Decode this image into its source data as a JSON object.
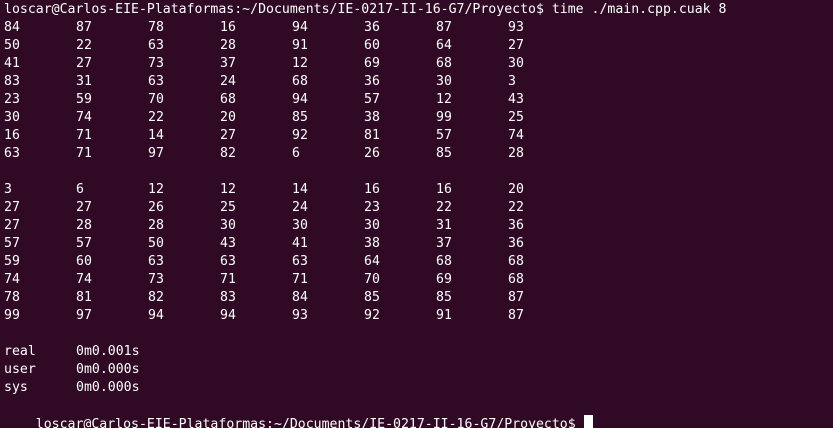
{
  "terminal": {
    "command_line": "loscar@Carlos-EIE-Plataformas:~/Documents/IE-0217-II-16-G7/Proyecto$ time ./main.cpp.cuak 8",
    "matrix_before": [
      [
        "84",
        "87",
        "78",
        "16",
        "94",
        "36",
        "87",
        "93"
      ],
      [
        "50",
        "22",
        "63",
        "28",
        "91",
        "60",
        "64",
        "27"
      ],
      [
        "41",
        "27",
        "73",
        "37",
        "12",
        "69",
        "68",
        "30"
      ],
      [
        "83",
        "31",
        "63",
        "24",
        "68",
        "36",
        "30",
        "3"
      ],
      [
        "23",
        "59",
        "70",
        "68",
        "94",
        "57",
        "12",
        "43"
      ],
      [
        "30",
        "74",
        "22",
        "20",
        "85",
        "38",
        "99",
        "25"
      ],
      [
        "16",
        "71",
        "14",
        "27",
        "92",
        "81",
        "57",
        "74"
      ],
      [
        "63",
        "71",
        "97",
        "82",
        "6",
        "26",
        "85",
        "28"
      ]
    ],
    "matrix_after": [
      [
        "3",
        "6",
        "12",
        "12",
        "14",
        "16",
        "16",
        "20"
      ],
      [
        "27",
        "27",
        "26",
        "25",
        "24",
        "23",
        "22",
        "22"
      ],
      [
        "27",
        "28",
        "28",
        "30",
        "30",
        "30",
        "31",
        "36"
      ],
      [
        "57",
        "57",
        "50",
        "43",
        "41",
        "38",
        "37",
        "36"
      ],
      [
        "59",
        "60",
        "63",
        "63",
        "63",
        "64",
        "68",
        "68"
      ],
      [
        "74",
        "74",
        "73",
        "71",
        "71",
        "70",
        "69",
        "68"
      ],
      [
        "78",
        "81",
        "82",
        "83",
        "84",
        "85",
        "85",
        "87"
      ],
      [
        "99",
        "97",
        "94",
        "94",
        "93",
        "92",
        "91",
        "87"
      ]
    ],
    "timing": {
      "real_label": "real",
      "real_value": "0m0.001s",
      "user_label": "user",
      "user_value": "0m0.000s",
      "sys_label": "sys",
      "sys_value": "0m0.000s"
    },
    "prompt": "loscar@Carlos-EIE-Plataformas:~/Documents/IE-0217-II-16-G7/Proyecto$",
    "colors": {
      "background": "#300a24",
      "text": "#ffffff"
    }
  }
}
